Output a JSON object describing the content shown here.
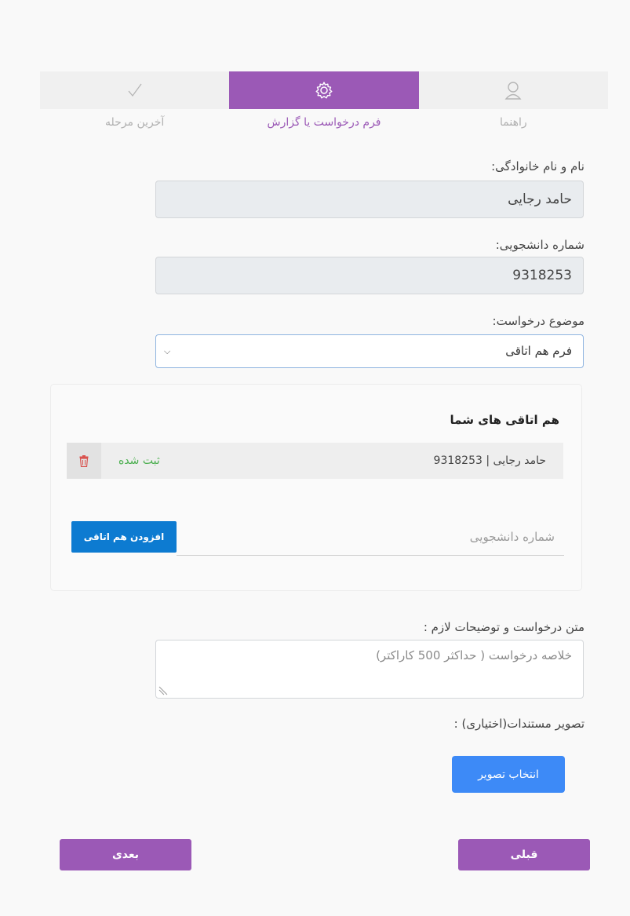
{
  "stepper": {
    "steps": [
      {
        "label": "راهنما",
        "icon": "user-icon",
        "active": false
      },
      {
        "label": "فرم درخواست یا گزارش",
        "icon": "gear-icon",
        "active": true
      },
      {
        "label": "آخرین مرحله",
        "icon": "check-icon",
        "active": false
      }
    ],
    "accent_color": "#9b59b6"
  },
  "form": {
    "full_name_label": "نام و نام خانوادگی:",
    "full_name_value": "حامد  رجایی",
    "student_number_label": "شماره دانشجویی:",
    "student_number_value": "9318253",
    "subject_label": "موضوع درخواست:",
    "subject_selected": "فرم هم اتاقی"
  },
  "roommates": {
    "title": "هم اتاقی های شما",
    "items": [
      {
        "text": "حامد رجایی | 9318253",
        "status": "ثبت شده"
      }
    ],
    "input_placeholder": "شماره دانشجویی",
    "add_button_label": "افزودن هم اتاقی"
  },
  "request": {
    "text_label": "متن درخواست و توضیحات لازم :",
    "text_placeholder": "خلاصه درخواست ( حداکثر 500 کاراکتر)",
    "docs_label": "تصویر مستندات(اختیاری) :",
    "pick_image_label": "انتخاب تصویر"
  },
  "nav": {
    "prev_label": "قبلی",
    "next_label": "بعدی"
  }
}
